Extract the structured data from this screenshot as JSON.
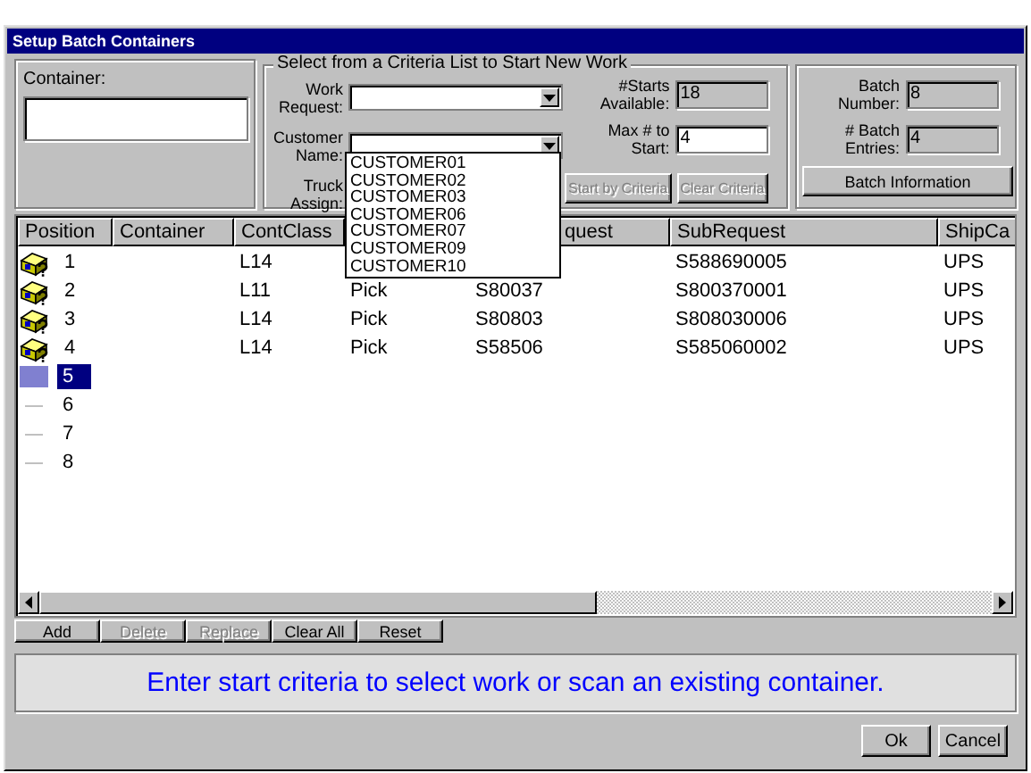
{
  "window": {
    "title": "Setup Batch Containers"
  },
  "container_group": {
    "label": "Container:"
  },
  "criteria": {
    "legend": "Select from a Criteria List to Start New Work",
    "combos": [
      {
        "label": "Work Request:",
        "has_field": true
      },
      {
        "label": "Customer Name:",
        "has_field": true
      },
      {
        "label": "Truck Assign:",
        "has_field": false
      }
    ],
    "starts_available": {
      "label": "#Starts Available:",
      "value": "18"
    },
    "max_to_start": {
      "label": "Max # to Start:",
      "value": "4"
    },
    "buttons": [
      {
        "label": "Start by Criteria",
        "disabled": true
      },
      {
        "label": "Clear Criteria",
        "disabled": true
      }
    ]
  },
  "batch": {
    "number": {
      "label": "Batch Number:",
      "value": "8"
    },
    "entries": {
      "label": "# Batch Entries:",
      "value": "4"
    },
    "button": "Batch Information"
  },
  "dropdown": {
    "items": [
      "CUSTOMER01",
      "CUSTOMER02",
      "CUSTOMER03",
      "CUSTOMER06",
      "CUSTOMER07",
      "CUSTOMER09",
      "CUSTOMER10"
    ]
  },
  "grid": {
    "columns": [
      {
        "label": "Position"
      },
      {
        "label": "Container"
      },
      {
        "label": "ContClass"
      },
      {},
      {
        "label": "quest"
      },
      {
        "label": "SubRequest"
      },
      {
        "label": "ShipCa"
      }
    ],
    "rows": [
      {
        "kind": "container",
        "selected": false,
        "cells": [
          "1",
          "",
          "L14",
          null,
          null,
          "S588690005",
          "UPS"
        ]
      },
      {
        "kind": "container",
        "selected": false,
        "cells": [
          "2",
          "",
          "L11",
          "Pick",
          "S80037",
          "S800370001",
          "UPS"
        ]
      },
      {
        "kind": "container",
        "selected": false,
        "cells": [
          "3",
          "",
          "L14",
          "Pick",
          "S80803",
          "S808030006",
          "UPS"
        ]
      },
      {
        "kind": "container",
        "selected": false,
        "cells": [
          "4",
          "",
          "L14",
          "Pick",
          "S58506",
          "S585060002",
          "UPS"
        ]
      },
      {
        "kind": "empty",
        "selected": true,
        "cells": [
          "5"
        ]
      },
      {
        "kind": "empty",
        "selected": false,
        "cells": [
          "6"
        ]
      },
      {
        "kind": "empty",
        "selected": false,
        "cells": [
          "7"
        ]
      },
      {
        "kind": "empty",
        "selected": false,
        "cells": [
          "8"
        ]
      }
    ]
  },
  "grid_buttons": [
    {
      "label": "Add",
      "disabled": false
    },
    {
      "label": "Delete",
      "disabled": true
    },
    {
      "label": "Replace",
      "disabled": true
    },
    {
      "label": "Clear All",
      "disabled": false
    },
    {
      "label": "Reset",
      "disabled": false
    }
  ],
  "status_message": "Enter start criteria to select work or scan an existing container.",
  "dialog_buttons": [
    "Ok",
    "Cancel"
  ]
}
